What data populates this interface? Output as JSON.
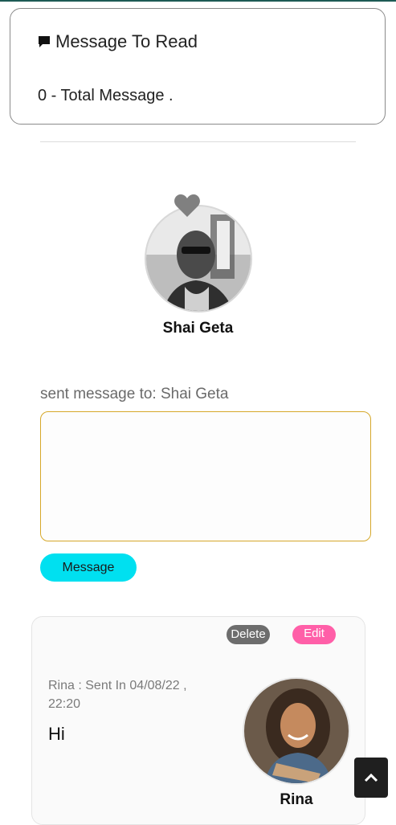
{
  "inbox": {
    "title": "Message To Read",
    "total_text": "0 - Total Message ."
  },
  "recipient": {
    "name": "Shai Geta",
    "favorite_icon": "heart-icon"
  },
  "compose": {
    "label": "sent message to: Shai Geta",
    "placeholder": "",
    "value": "",
    "send_label": "Message"
  },
  "thread": {
    "delete_label": "Delete",
    "edit_label": "Edit",
    "sender_meta": "Rina : Sent In 04/08/22 , 22:20",
    "message": "Hi",
    "sender_name": "Rina"
  },
  "colors": {
    "send_button": "#00e0f0",
    "edit_button": "#ff5fa8",
    "delete_button": "#6d6d6d",
    "textarea_border": "#d6a82a"
  },
  "icons": {
    "inbox": "message-icon",
    "scroll_top": "chevron-up-icon"
  }
}
